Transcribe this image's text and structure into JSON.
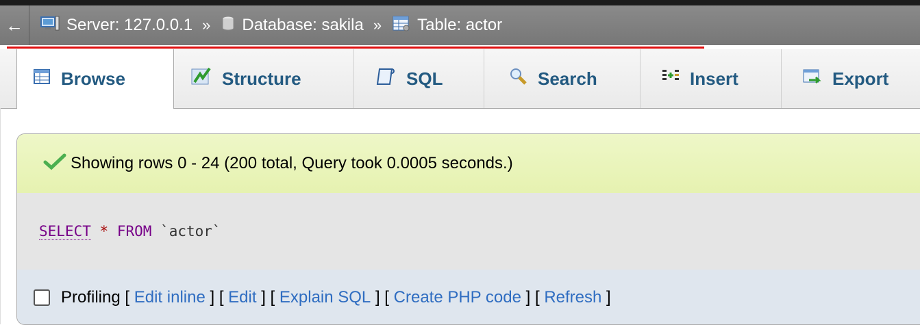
{
  "breadcrumb": {
    "back_arrow": "←",
    "separator": "»",
    "server": "Server: 127.0.0.1",
    "database": "Database: sakila",
    "table": "Table: actor"
  },
  "tabs": [
    {
      "label": "Browse",
      "icon": "browse-table-icon",
      "active": true
    },
    {
      "label": "Structure",
      "icon": "structure-icon",
      "active": false
    },
    {
      "label": "SQL",
      "icon": "sql-document-icon",
      "active": false
    },
    {
      "label": "Search",
      "icon": "search-icon",
      "active": false
    },
    {
      "label": "Insert",
      "icon": "insert-icon",
      "active": false
    },
    {
      "label": "Export",
      "icon": "export-icon",
      "active": false
    }
  ],
  "message": {
    "text": "Showing rows 0 - 24 (200 total, Query took 0.0005 seconds.)",
    "icon": "success-check-icon"
  },
  "sql": {
    "select": "SELECT",
    "star": "*",
    "from": "FROM",
    "table": "`actor`"
  },
  "profiling": {
    "label": "Profiling",
    "open": "[",
    "close": "]",
    "links": [
      "Edit inline",
      "Edit",
      "Explain SQL",
      "Create PHP code",
      "Refresh"
    ]
  },
  "colors": {
    "tab_text": "#235a81",
    "link": "#2f6dc1",
    "success_bg": "#e6f2b0",
    "highlight_line": "#e01010"
  }
}
